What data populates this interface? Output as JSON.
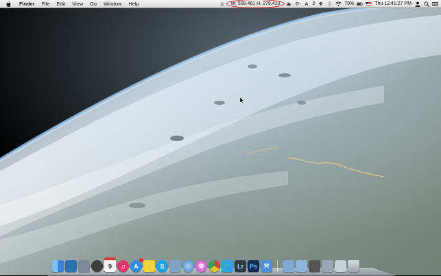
{
  "menubar": {
    "app_name": "Finder",
    "menus": [
      "File",
      "Edit",
      "View",
      "Go",
      "Window",
      "Help"
    ],
    "dimensions_readout": "W: 508.461 H: 279.410",
    "notification_count": "2",
    "battery_percent": "79%",
    "clock": "Thu 12:41:27 PM"
  },
  "dock": {
    "apps": [
      {
        "name": "Finder",
        "color": "#3b7fd6"
      },
      {
        "name": "Dashboard",
        "color": "#2a6fb0"
      },
      {
        "name": "Preview",
        "color": "#7d8a96"
      },
      {
        "name": "Time Machine",
        "color": "#3c3c3c"
      },
      {
        "name": "Calendar",
        "color": "#f4f4f4",
        "label": "9"
      },
      {
        "name": "iTunes",
        "color": "#e8336a"
      },
      {
        "name": "App Store",
        "color": "#2f8de4"
      },
      {
        "name": "Stickies",
        "color": "#f2d53c"
      },
      {
        "name": "Skype",
        "color": "#1aa3e8",
        "label": "S"
      },
      {
        "name": "Preview Photo",
        "color": "#7fa2c7"
      },
      {
        "name": "Safari",
        "color": "#6ea6d8"
      },
      {
        "name": "Game Center",
        "color": "#c940c8"
      },
      {
        "name": "Chrome",
        "color": "#e6b325"
      },
      {
        "name": "Twitter",
        "color": "#2fa3e6"
      },
      {
        "name": "Lightroom",
        "color": "#2e3a44",
        "label": "Lr"
      },
      {
        "name": "Photoshop",
        "color": "#0f2c52",
        "label": "Ps"
      },
      {
        "name": "Xcode",
        "color": "#4a8fd8"
      }
    ],
    "docs": [
      {
        "name": "Applications folder",
        "color": "#7fa8d6"
      },
      {
        "name": "Documents folder",
        "color": "#8fb4dc"
      },
      {
        "name": "Stack 1",
        "color": "#555"
      },
      {
        "name": "Stack 2",
        "color": "#9aa6b4"
      },
      {
        "name": "Stack 3",
        "color": "#c8d0d8"
      },
      {
        "name": "Trash",
        "color": "#b9c0c7"
      }
    ]
  }
}
